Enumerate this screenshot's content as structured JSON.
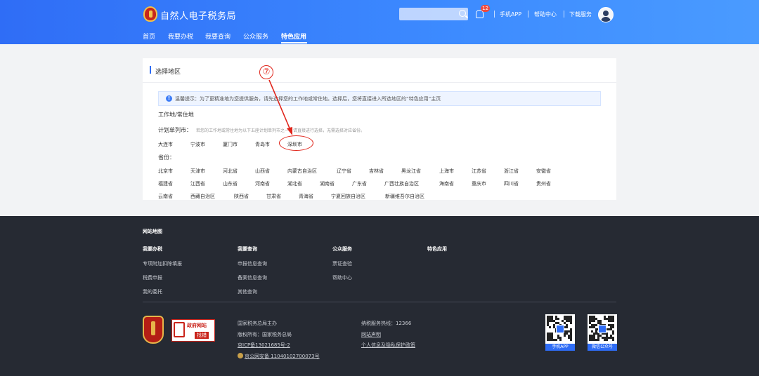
{
  "header": {
    "site_title": "自然人电子税务局",
    "notification_count": "12",
    "links": [
      "手机APP",
      "帮助中心",
      "下载服务"
    ],
    "nav": [
      "首页",
      "我要办税",
      "我要查询",
      "公众服务",
      "特色应用"
    ],
    "active_nav": "特色应用"
  },
  "card": {
    "title": "选择地区",
    "tip": "温馨提示：为了更精准地为您提供服务，请先选择您的工作地或常住地。选择后，您将直接进入所选地区的“特色应用”主页",
    "work_label": "工作地/常住地",
    "city_label": "计划单列市：",
    "city_hint": "若您的工作地或常住地为以下五座计划单列市之一，请直接进行选择，无需选择对应省份。",
    "cities": [
      "大连市",
      "宁波市",
      "厦门市",
      "青岛市",
      "深圳市"
    ],
    "province_label": "省份：",
    "provinces": [
      [
        "北京市",
        "天津市",
        "河北省",
        "山西省",
        "内蒙古自治区",
        "辽宁省",
        "吉林省",
        "黑龙江省",
        "上海市",
        "江苏省",
        "浙江省",
        "安徽省"
      ],
      [
        "福建省",
        "江西省",
        "山东省",
        "河南省",
        "湖北省",
        "湖南省",
        "广东省",
        "广西壮族自治区",
        "海南省",
        "重庆市",
        "四川省",
        "贵州省"
      ],
      [
        "云南省",
        "西藏自治区",
        "陕西省",
        "甘肃省",
        "青海省",
        "宁夏回族自治区",
        "新疆维吾尔自治区"
      ]
    ]
  },
  "annotation": {
    "step": "⑦",
    "color": "#e0251b"
  },
  "footer": {
    "sitemap_title": "网站地图",
    "columns": [
      {
        "title": "我要办税",
        "links": [
          "专项附加扣除填报",
          "税费申报",
          "我的委托"
        ]
      },
      {
        "title": "我要查询",
        "links": [
          "申报信息查询",
          "备案信息查询",
          "其他查询"
        ]
      },
      {
        "title": "公众服务",
        "links": [
          "票证查验",
          "帮助中心"
        ]
      },
      {
        "title": "特色应用",
        "links": []
      }
    ],
    "gov_badge_line1": "政府网站",
    "gov_badge_line2": "找错",
    "info_left": [
      "国家税务总局主办",
      "版权所有：国家税务总局",
      "京ICP备13021685号-2",
      "京公网安备 11040102700073号"
    ],
    "info_right": [
      "纳税服务热线：12366",
      "网站声明",
      "个人信息及隐私保护政策"
    ],
    "qr_labels": [
      "手机APP",
      "微信公众号"
    ]
  },
  "colors": {
    "header_blue": "#2f6df6",
    "footer_bg": "#262a33",
    "accent_red": "#e0251b"
  }
}
